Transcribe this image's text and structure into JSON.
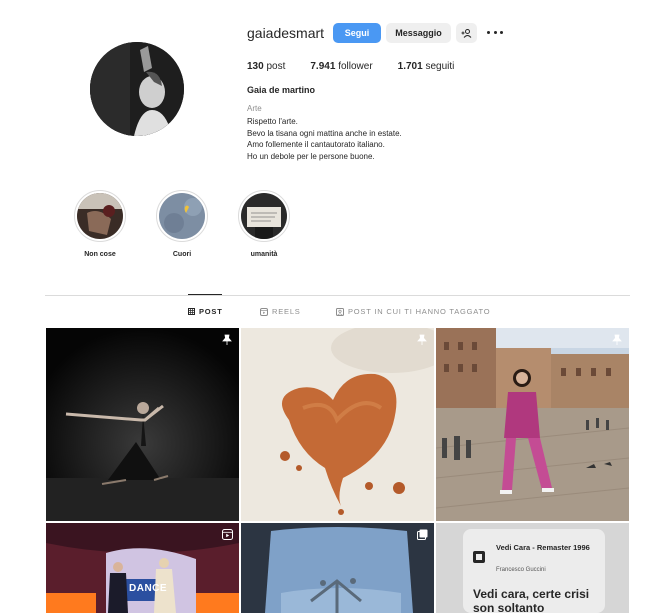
{
  "profile": {
    "username": "gaiadesmart",
    "follow_label": "Segui",
    "message_label": "Messaggio",
    "stats": {
      "posts_count": "130",
      "posts_label": "post",
      "followers_count": "7.941",
      "followers_label": "follower",
      "following_count": "1.701",
      "following_label": "seguiti"
    },
    "full_name": "Gaia de martino",
    "category": "Arte",
    "bio": [
      "Rispetto l'arte.",
      "Bevo la tisana ogni mattina anche in estate.",
      "Amo follemente il cantautorato italiano.",
      "Ho un debole per le persone buone."
    ]
  },
  "highlights": [
    {
      "label": "Non cose"
    },
    {
      "label": "Cuori"
    },
    {
      "label": "umanità"
    }
  ],
  "tabs": [
    {
      "label": "POST",
      "icon": "grid-icon",
      "active": true
    },
    {
      "label": "REELS",
      "icon": "reels-icon",
      "active": false
    },
    {
      "label": "POST IN CUI TI HANNO TAGGATO",
      "icon": "tagged-icon",
      "active": false
    }
  ],
  "posts": [
    {
      "type": "photo",
      "pinned": true,
      "description_icon": "pin-icon"
    },
    {
      "type": "photo",
      "pinned": true,
      "description_icon": "pin-icon"
    },
    {
      "type": "photo",
      "pinned": true,
      "description_icon": "pin-icon"
    },
    {
      "type": "reel",
      "description_icon": "reels-icon",
      "sign_text": "DANCE"
    },
    {
      "type": "carousel",
      "description_icon": "carousel-icon"
    },
    {
      "type": "music",
      "song_title": "Vedi Cara - Remaster 1996",
      "artist": "Francesco Guccini",
      "lyric": "Vedi cara, certe crisi son soltanto"
    }
  ],
  "colors": {
    "accent": "#4a98f3",
    "text": "#262626",
    "muted": "#8e8e8e",
    "border": "#dbdbdb"
  }
}
